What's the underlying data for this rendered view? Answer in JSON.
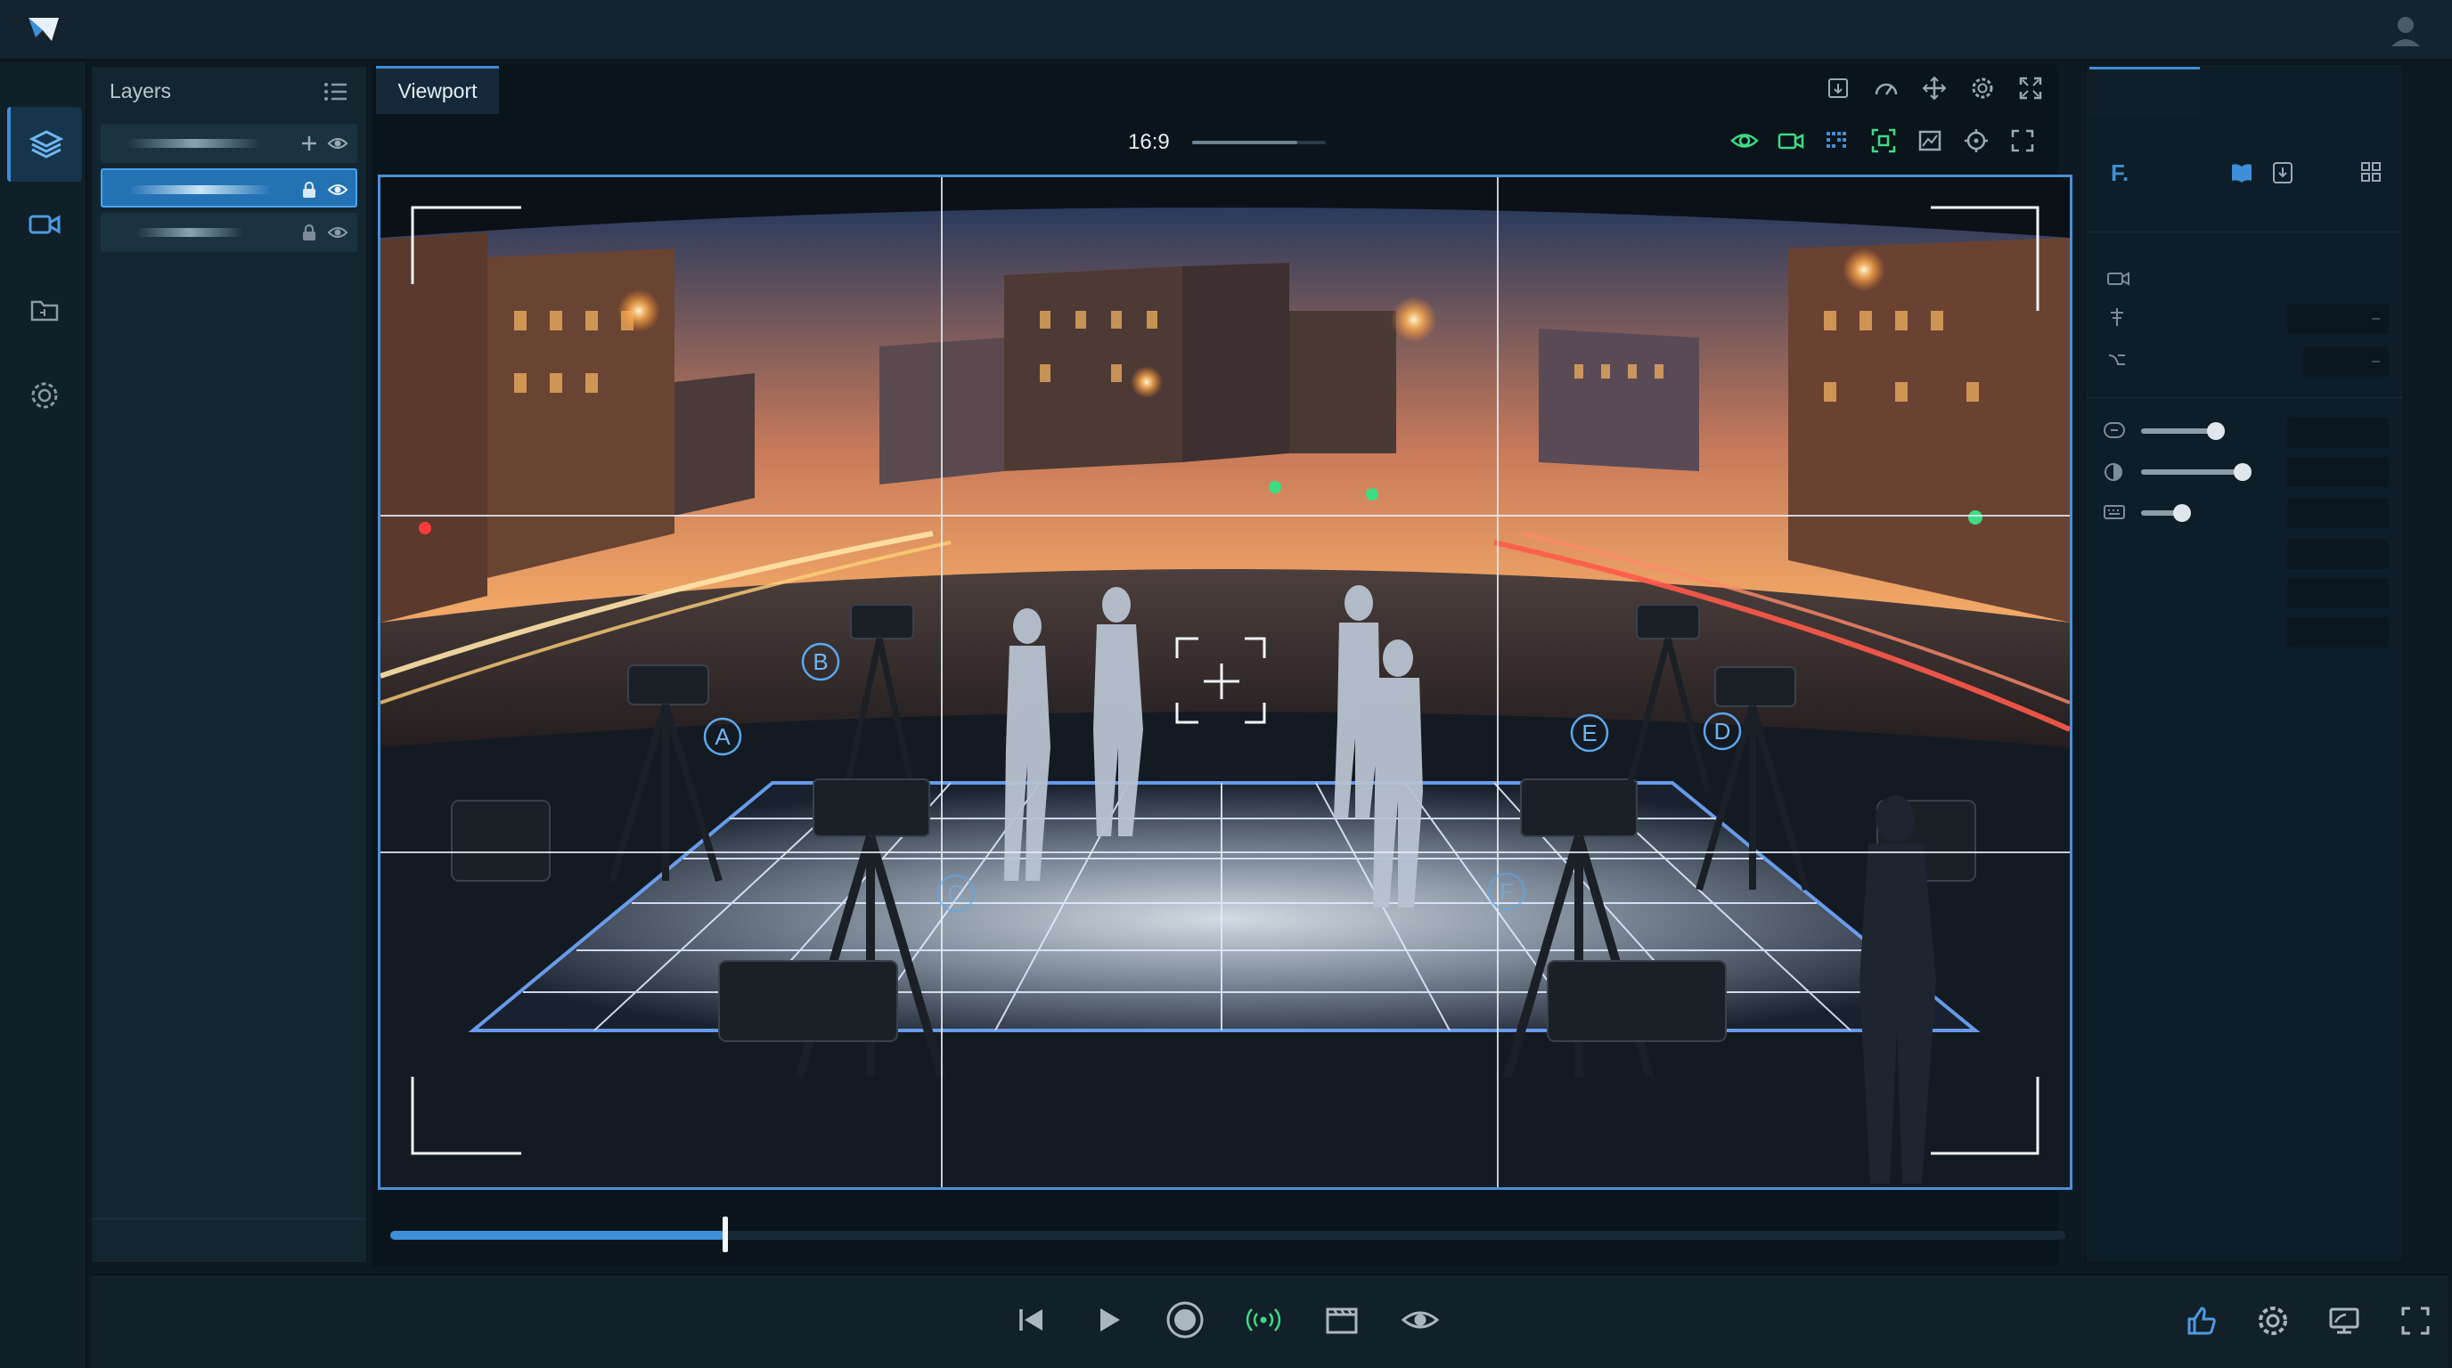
{
  "app": {
    "accent": "#3d8fd8",
    "green": "#3ddc84"
  },
  "layers_panel": {
    "title": "Layers",
    "rows": [
      {
        "state": "unlocked",
        "selected": false
      },
      {
        "state": "locked",
        "selected": true
      },
      {
        "state": "locked",
        "selected": false
      }
    ]
  },
  "viewport": {
    "tab_label": "Viewport",
    "aspect_ratio": "16:9",
    "markers": [
      "A",
      "B",
      "C",
      "D",
      "E",
      "F"
    ]
  },
  "right_panel": {
    "label": "F."
  },
  "timeline": {
    "progress": 0.2
  }
}
